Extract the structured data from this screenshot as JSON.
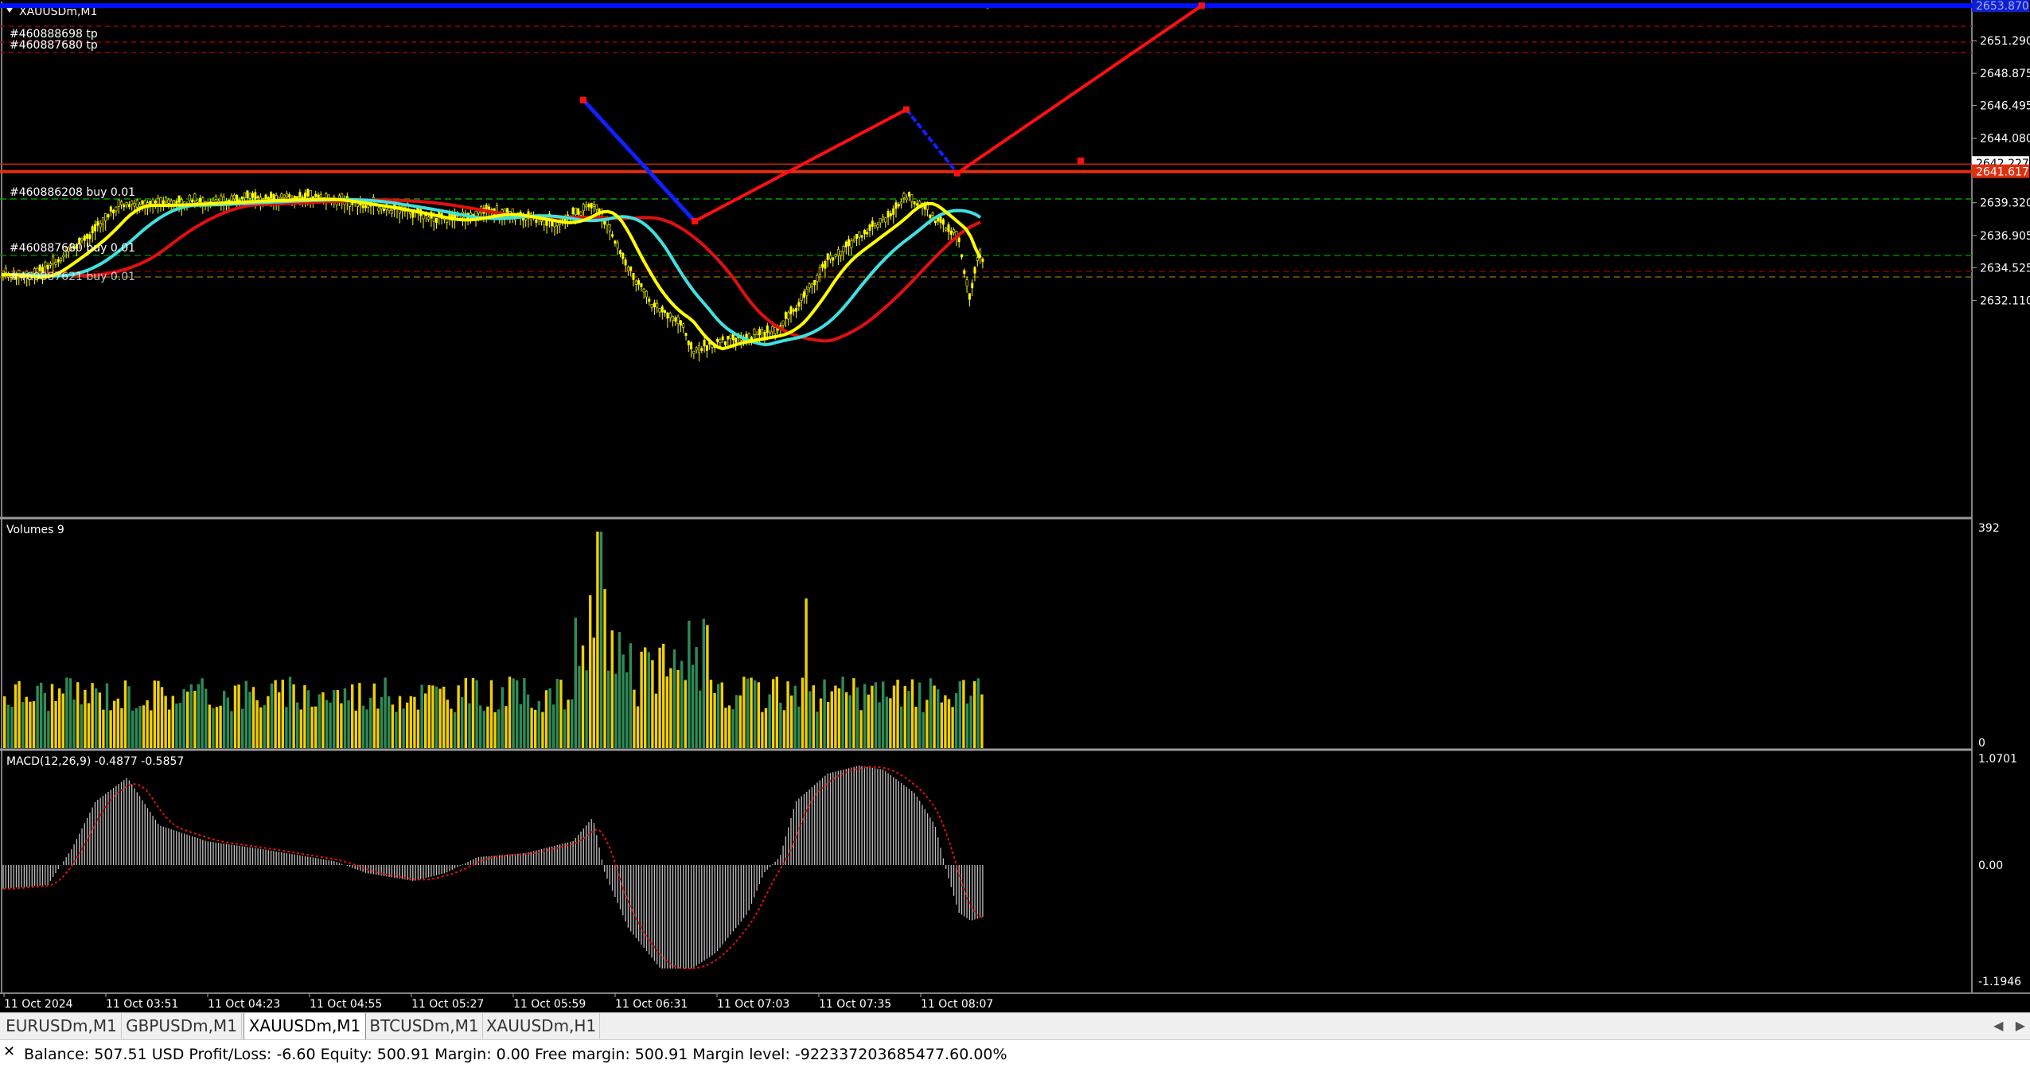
{
  "window": {
    "title": "XAUUSDm,M1"
  },
  "colors": {
    "background": "#000000",
    "bull_candle": "#ffff00",
    "ma_fast": "#ffff00",
    "ma_mid": "#40e0e0",
    "ma_slow": "#e01010",
    "zigzag_down": "#1020ff",
    "zigzag_up": "#ff1010",
    "volume_up": "#2e8b57",
    "volume_down": "#f0d000",
    "macd_hist": "#c0c0c0",
    "macd_signal": "#e01010",
    "level_line": "#e03010",
    "tp_line": "#a00000",
    "order_line": "#00a000",
    "top_line": "#0010ff"
  },
  "price_pane": {
    "axis_labels": [
      "2651.290",
      "2648.875",
      "2646.495",
      "2644.080",
      "2639.320",
      "2636.905",
      "2634.525",
      "2632.110"
    ],
    "ylim": [
      2630.9,
      2653.7
    ],
    "current_price_labels": [
      "2642.227",
      "2641.617"
    ],
    "top_price_label": "2653.870",
    "order_labels": [
      "#460888698 tp",
      "#460887680 tp",
      "#460886208 buy 0.01",
      "#460887680 buy 0.01",
      "#460887621 buy 0.01"
    ]
  },
  "volume_pane": {
    "title": "Volumes 9",
    "axis_labels": [
      "392",
      "0"
    ]
  },
  "macd_pane": {
    "title": "MACD(12,26,9) -0.4877 -0.5857",
    "axis_labels": [
      "1.0701",
      "0.00",
      "-1.1946"
    ]
  },
  "time_axis": {
    "labels": [
      "11 Oct 2024",
      "11 Oct 03:51",
      "11 Oct 04:23",
      "11 Oct 04:55",
      "11 Oct 05:27",
      "11 Oct 05:59",
      "11 Oct 06:31",
      "11 Oct 07:03",
      "11 Oct 07:35",
      "11 Oct 08:07"
    ]
  },
  "chart_data": {
    "type": "line",
    "symbol": "XAUUSDm",
    "timeframe": "M1",
    "ylim": [
      2630.9,
      2653.7
    ],
    "zigzag_prices": [
      2646.9,
      2637.95,
      2646.2,
      2641.5,
      2653.87
    ],
    "levels": [
      2641.617,
      2642.227,
      2653.87
    ]
  },
  "tabs": [
    {
      "label": "EURUSDm,M1"
    },
    {
      "label": "GBPUSDm,M1"
    },
    {
      "label": "XAUUSDm,M1"
    },
    {
      "label": "BTCUSDm,M1"
    },
    {
      "label": "XAUUSDm,H1"
    }
  ],
  "active_tab": 2,
  "status": {
    "text": "Balance: 507.51 USD  Profit/Loss: -6.60  Equity: 500.91  Margin: 0.00  Free margin: 500.91  Margin level: -922337203685477.60.00%"
  }
}
